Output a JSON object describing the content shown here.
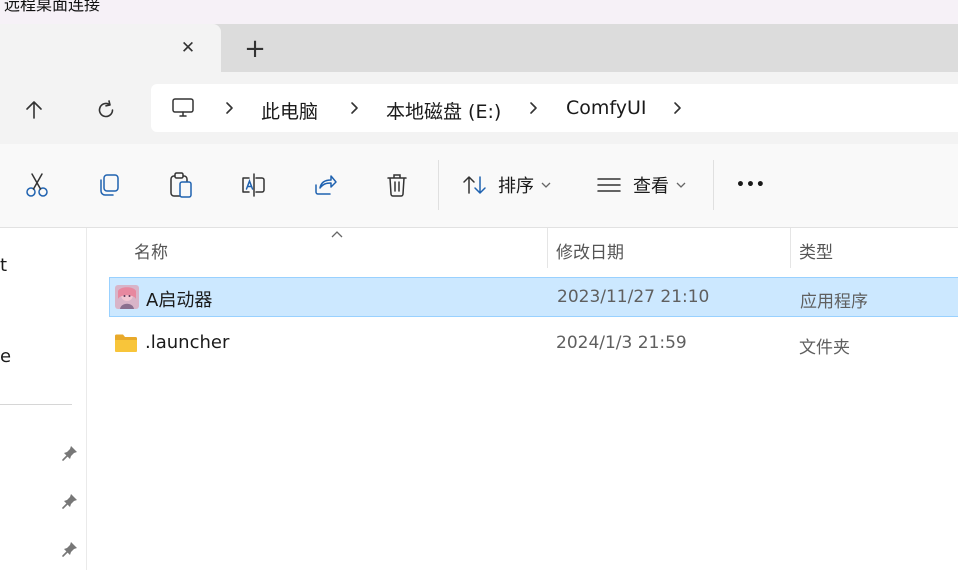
{
  "window": {
    "title": "远程桌面连接"
  },
  "tabs": {
    "close_glyph": "✕",
    "new_tab_glyph": "+"
  },
  "navigation": {
    "icons": [
      "up-arrow-icon",
      "refresh-icon",
      "computer-icon"
    ],
    "breadcrumb": [
      "此电脑",
      "本地磁盘 (E:)",
      "ComfyUI"
    ]
  },
  "toolbar": {
    "icons": [
      "cut-icon",
      "copy-icon",
      "paste-icon",
      "rename-icon",
      "share-icon",
      "delete-icon"
    ],
    "sort_label": "排序",
    "view_label": "查看",
    "more_glyph": "•••"
  },
  "nav_pane": {
    "fragment_1": "t",
    "fragment_2": "e"
  },
  "file_list": {
    "columns": {
      "name": "名称",
      "modified": "修改日期",
      "type": "类型"
    },
    "rows": [
      {
        "name": "A启动器",
        "modified": "2023/11/27 21:10",
        "type": "应用程序",
        "icon": "app-icon",
        "selected": true
      },
      {
        "name": ".launcher",
        "modified": "2024/1/3 21:59",
        "type": "文件夹",
        "icon": "folder-icon",
        "selected": false
      }
    ]
  },
  "colors": {
    "selection_bg": "#cce8ff",
    "selection_border": "#99d1ff",
    "folder_yellow": "#f8c53a",
    "accent": "#1f62b0"
  }
}
